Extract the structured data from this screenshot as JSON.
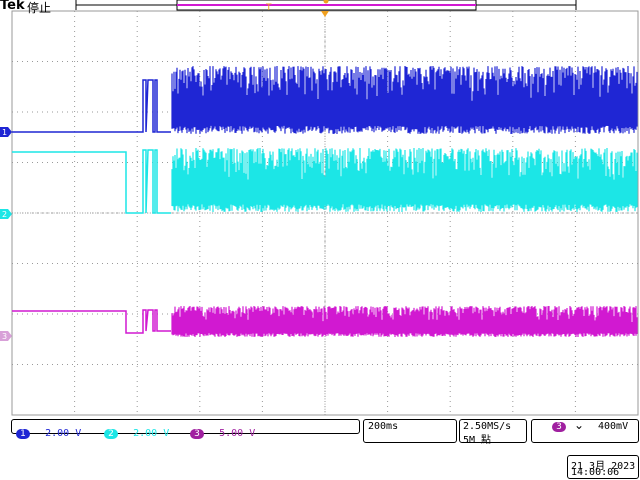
{
  "header": {
    "brand": "Tek",
    "status": "停止"
  },
  "channels": [
    {
      "number": "1",
      "scale": "2.00 V",
      "color": "#1f26d4"
    },
    {
      "number": "2",
      "scale": "2.00 V",
      "color": "#1ce6e6"
    },
    {
      "number": "3",
      "scale": "5.00 V",
      "color": "#d119d1"
    }
  ],
  "timebase": {
    "value": "200ms"
  },
  "acquisition": {
    "rate": "2.50MS/s",
    "record": "5M 點"
  },
  "trigger": {
    "source": "3",
    "slope_icon": "falling-edge-icon",
    "slope_glyph": "⌄",
    "level": "400mV"
  },
  "datetime": {
    "date": "21 3月  2023",
    "time": "14:00:06"
  },
  "colors": {
    "ch1": "#1f26d4",
    "ch2": "#1ce6e6",
    "ch3": "#d119d1",
    "trigger_marker": "#f0a020",
    "grid": "#9a9a9a"
  }
}
